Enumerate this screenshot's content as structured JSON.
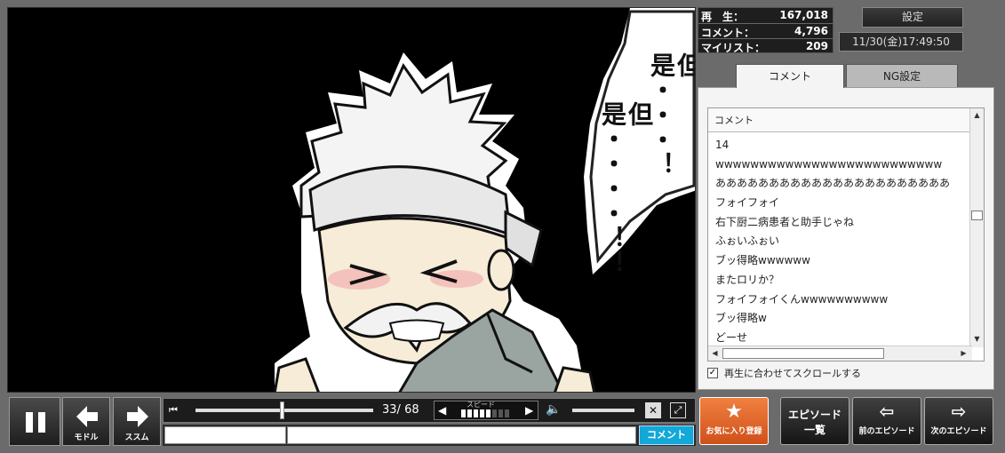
{
  "stats": {
    "plays_label": "再　生：",
    "plays": "167,018",
    "comments_label": "コメント：",
    "comments": "4,796",
    "mylist_label": "マイリスト：",
    "mylist": "209"
  },
  "settings_label": "設定",
  "datetime": "11/30(金)17:49:50",
  "video": {
    "speech_right": "但是・・・！",
    "speech_left": "但是・・・・！！"
  },
  "tabs": {
    "comment": "コメント",
    "ng": "NG設定"
  },
  "comment_list": {
    "header": "コメント",
    "rows": [
      "14",
      "wwwwwwwwwwwwwwwwwwwwwwwwww",
      "ああああああああああああああああああああああ",
      "フォイフォイ",
      "右下厨二病患者と助手じゃね",
      "ふぉいふぉい",
      "ブッ得略wwwwww",
      "またロリか？",
      "フォイフォイくんwwwwwwwwww",
      "ブッ得略w",
      "どーせ"
    ]
  },
  "scroll_sync_label": "再生に合わせてスクロールする",
  "controls": {
    "back_label": "モドル",
    "forward_label": "ススム",
    "time_current": "33",
    "time_total": "68",
    "seek_progress": 0.485,
    "speed_label": "スピード",
    "speed_level": 5,
    "speed_max": 8,
    "volume_level": 1.0,
    "comment_submit": "コメント"
  },
  "actions": {
    "favorite": "お気に入り登録",
    "episode_list_1": "エピソード",
    "episode_list_2": "一覧",
    "prev_episode": "前のエピソード",
    "next_episode": "次のエピソード"
  },
  "colors": {
    "favorite_bg": "#e8662a",
    "comment_submit_bg": "#12a8d8"
  }
}
